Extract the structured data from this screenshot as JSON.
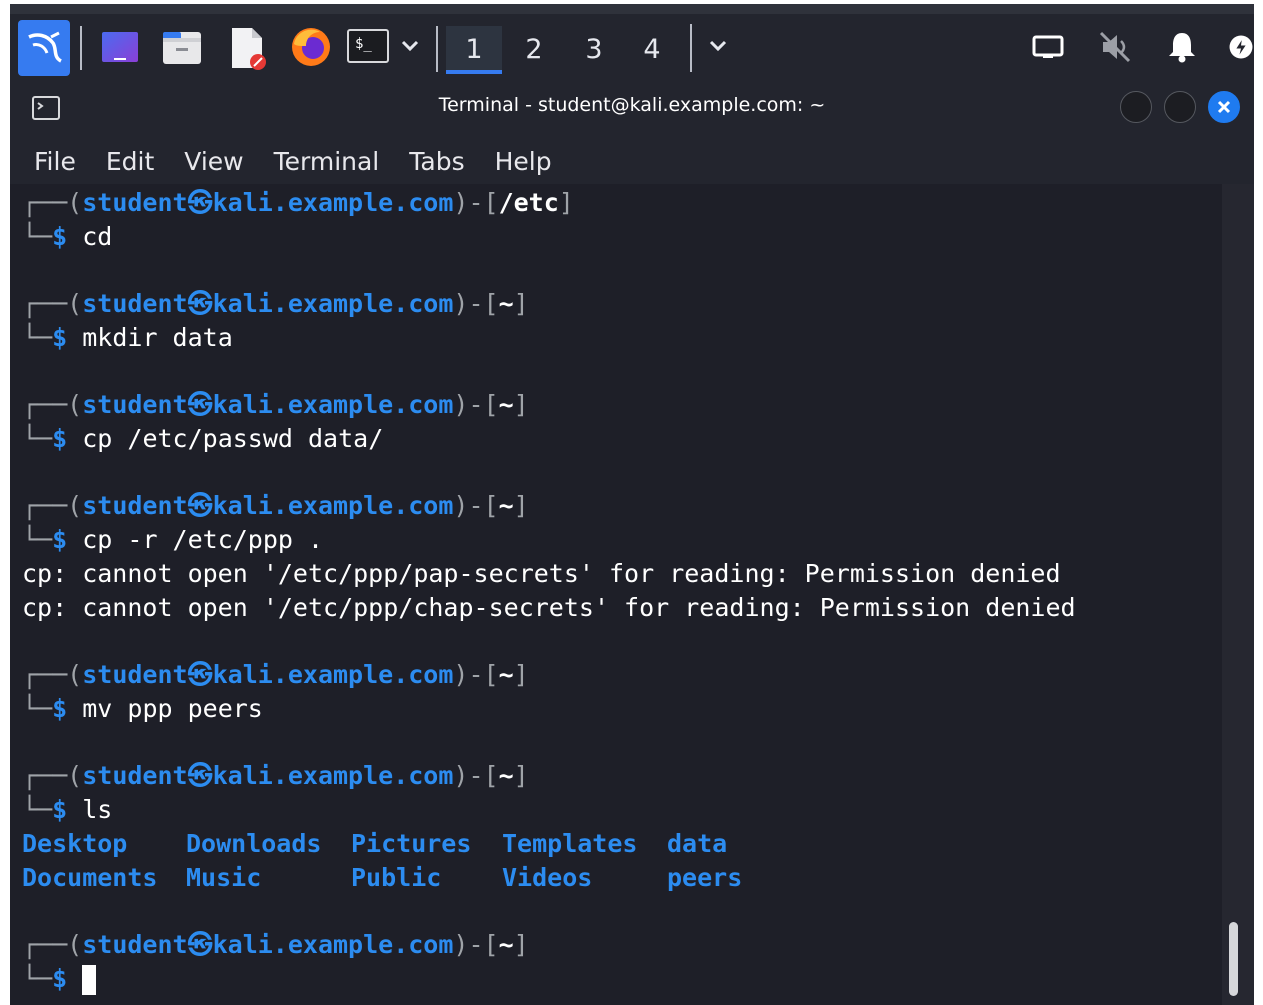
{
  "panel": {
    "workspaces": [
      {
        "label": "1",
        "active": true
      },
      {
        "label": "2",
        "active": false
      },
      {
        "label": "3",
        "active": false
      },
      {
        "label": "4",
        "active": false
      }
    ]
  },
  "window": {
    "title": "Terminal - student@kali.example.com: ~",
    "menu": [
      "File",
      "Edit",
      "View",
      "Terminal",
      "Tabs",
      "Help"
    ]
  },
  "terminal": {
    "user": "student",
    "host": "kali.example.com",
    "blocks": [
      {
        "path": "/etc",
        "command": "cd",
        "output": []
      },
      {
        "path": "~",
        "command": "mkdir data",
        "output": []
      },
      {
        "path": "~",
        "command": "cp /etc/passwd data/",
        "output": []
      },
      {
        "path": "~",
        "command": "cp -r /etc/ppp .",
        "output": [
          "cp: cannot open '/etc/ppp/pap-secrets' for reading: Permission denied",
          "cp: cannot open '/etc/ppp/chap-secrets' for reading: Permission denied"
        ]
      },
      {
        "path": "~",
        "command": "mv ppp peers",
        "output": []
      },
      {
        "path": "~",
        "command": "ls",
        "output": []
      },
      {
        "path": "~",
        "command": "",
        "output": []
      }
    ],
    "ls_listing": [
      [
        "Desktop",
        "Downloads",
        "Pictures",
        "Templates",
        "data"
      ],
      [
        "Documents",
        "Music",
        "Public",
        "Videos",
        "peers"
      ]
    ]
  },
  "colors": {
    "accent": "#367bf0",
    "prompt_blue": "#2c8cf0",
    "background": "#1e1f28"
  }
}
